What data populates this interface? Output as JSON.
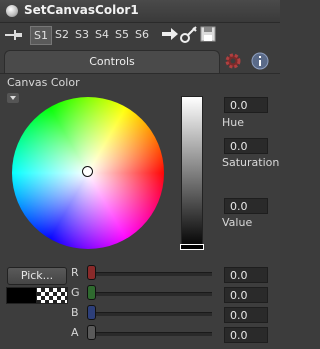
{
  "title": "SetCanvasColor1",
  "toolbar": {
    "slots": [
      "S1",
      "S2",
      "S3",
      "S4",
      "S5",
      "S6"
    ],
    "active_slot": "S1"
  },
  "tabs": {
    "controls": "Controls"
  },
  "canvas_color_label": "Canvas Color",
  "hsv": {
    "hue_label": "Hue",
    "hue_value": "0.0",
    "saturation_label": "Saturation",
    "saturation_value": "0.0",
    "value_label": "Value",
    "value_value": "0.0"
  },
  "pick_button": "Pick...",
  "channels": [
    {
      "label": "R",
      "value": "0.0",
      "color": "#8a2a2a"
    },
    {
      "label": "G",
      "value": "0.0",
      "color": "#2f6a2f"
    },
    {
      "label": "B",
      "value": "0.0",
      "color": "#2d3f7a"
    },
    {
      "label": "A",
      "value": "0.0",
      "color": "#5a5a5a"
    }
  ],
  "icons": [
    "pin-icon",
    "arrow-right-icon",
    "link-icon",
    "save-icon",
    "gear-icon",
    "info-icon",
    "dropdown-icon"
  ]
}
